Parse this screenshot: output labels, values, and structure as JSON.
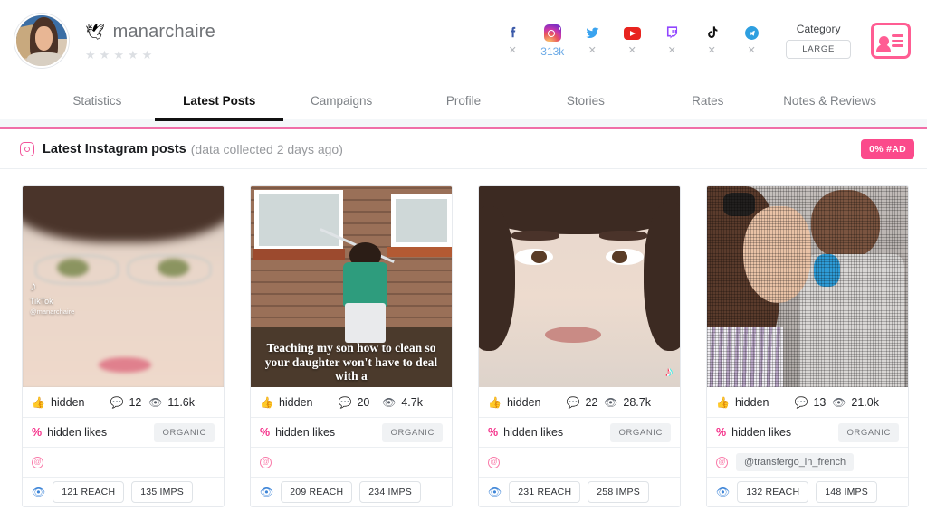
{
  "profile": {
    "bird_icon": "🕊",
    "username": "manarchaire",
    "rating_stars": 5,
    "rating_filled": 0,
    "avatar_name": "profile-avatar"
  },
  "socials": [
    {
      "network": "facebook",
      "icon": "facebook-icon",
      "value": "✕",
      "active": false
    },
    {
      "network": "instagram",
      "icon": "instagram-icon",
      "value": "313k",
      "active": true
    },
    {
      "network": "twitter",
      "icon": "twitter-icon",
      "value": "✕",
      "active": false
    },
    {
      "network": "youtube",
      "icon": "youtube-icon",
      "value": "✕",
      "active": false
    },
    {
      "network": "twitch",
      "icon": "twitch-icon",
      "value": "✕",
      "active": false
    },
    {
      "network": "tiktok",
      "icon": "tiktok-icon",
      "value": "✕",
      "active": false
    },
    {
      "network": "telegram",
      "icon": "telegram-icon",
      "value": "✕",
      "active": false
    }
  ],
  "category": {
    "label": "Category",
    "value": "LARGE"
  },
  "tabs": [
    {
      "label": "Statistics",
      "active": false
    },
    {
      "label": "Latest Posts",
      "active": true
    },
    {
      "label": "Campaigns",
      "active": false
    },
    {
      "label": "Profile",
      "active": false
    },
    {
      "label": "Stories",
      "active": false
    },
    {
      "label": "Rates",
      "active": false
    },
    {
      "label": "Notes & Reviews",
      "active": false
    }
  ],
  "panel": {
    "title": "Latest Instagram posts",
    "subtitle": "(data collected 2 days ago)",
    "ad_badge": "0% #AD"
  },
  "posts": [
    {
      "likes": "hidden",
      "comments": "12",
      "views": "11.6k",
      "likes_pct": "%",
      "likes_text": "hidden likes",
      "type_badge": "ORGANIC",
      "mention": "",
      "reach": "121 REACH",
      "imps": "135 IMPS",
      "thumb_caption": "",
      "watermark_brand": "TikTok",
      "watermark_user": "@manarchaire"
    },
    {
      "likes": "hidden",
      "comments": "20",
      "views": "4.7k",
      "likes_pct": "%",
      "likes_text": "hidden likes",
      "type_badge": "ORGANIC",
      "mention": "",
      "reach": "209 REACH",
      "imps": "234 IMPS",
      "thumb_caption": "Teaching my son how to clean so your daughter won't have to deal with a",
      "watermark_brand": "",
      "watermark_user": ""
    },
    {
      "likes": "hidden",
      "comments": "22",
      "views": "28.7k",
      "likes_pct": "%",
      "likes_text": "hidden likes",
      "type_badge": "ORGANIC",
      "mention": "",
      "reach": "231 REACH",
      "imps": "258 IMPS",
      "thumb_caption": "",
      "watermark_brand": "",
      "watermark_user": ""
    },
    {
      "likes": "hidden",
      "comments": "13",
      "views": "21.0k",
      "likes_pct": "%",
      "likes_text": "hidden likes",
      "type_badge": "ORGANIC",
      "mention": "@transfergo_in_french",
      "reach": "132 REACH",
      "imps": "148 IMPS",
      "thumb_caption": "",
      "watermark_brand": "",
      "watermark_user": ""
    }
  ],
  "colors": {
    "accent_pink": "#fb4a8b",
    "panel_border_pink": "#f06fa8",
    "active_tab": "#111111",
    "instagram_value": "#6aa9e6",
    "page_bg": "#f4f7f9"
  }
}
